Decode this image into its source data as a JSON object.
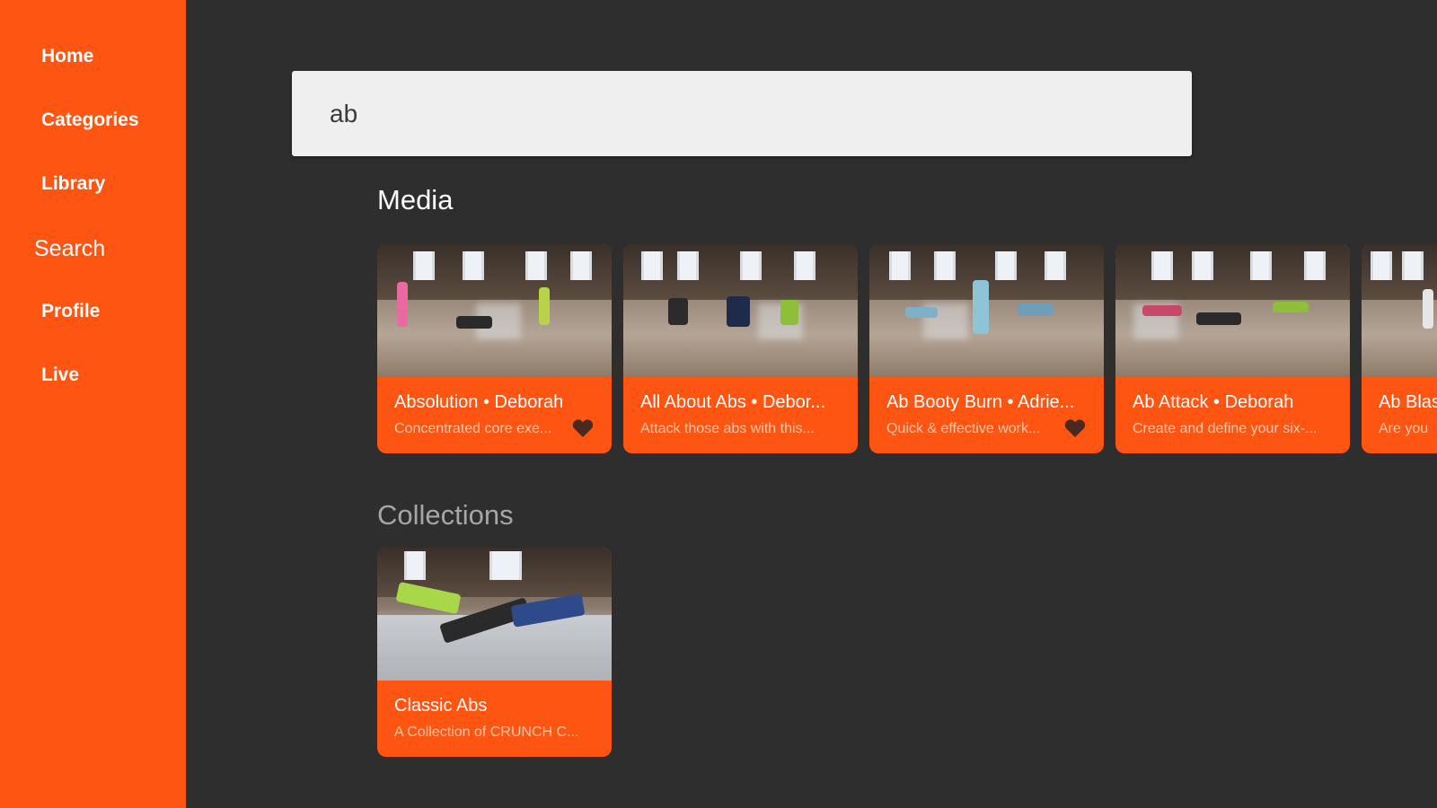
{
  "sidebar": {
    "items": [
      {
        "label": "Home"
      },
      {
        "label": "Categories"
      },
      {
        "label": "Library"
      },
      {
        "label": "Search",
        "active": true
      },
      {
        "label": "Profile"
      },
      {
        "label": "Live"
      }
    ]
  },
  "search": {
    "value": "ab"
  },
  "media": {
    "title": "Media",
    "cards": [
      {
        "title": "Absolution • Deborah",
        "subtitle": "Concentrated core exe...",
        "favorited": true
      },
      {
        "title": "All About Abs • Debor...",
        "subtitle": "Attack those abs with this...",
        "favorited": false
      },
      {
        "title": "Ab Booty Burn • Adrie...",
        "subtitle": "Quick & effective work...",
        "favorited": true
      },
      {
        "title": "Ab Attack • Deborah",
        "subtitle": "Create and define your six-...",
        "favorited": false
      },
      {
        "title": "Ab Blas",
        "subtitle": "Are you",
        "favorited": false
      }
    ]
  },
  "collections": {
    "title": "Collections",
    "cards": [
      {
        "title": "Classic Abs",
        "subtitle": "A Collection of CRUNCH C..."
      }
    ]
  },
  "colors": {
    "accent": "#fe5512",
    "background": "#2e2e2e",
    "search_bg": "#efefef"
  },
  "icons": {
    "favorite": "heart-icon"
  }
}
